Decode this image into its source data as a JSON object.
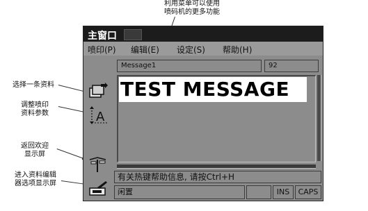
{
  "annotations": {
    "top": [
      "利用菜单可以使用",
      "喷码机的更多功能"
    ],
    "side_1": "选择一条资料",
    "side_2": [
      "调整喷印",
      "资料参数"
    ],
    "side_3": [
      "返回欢迎",
      "显示屏"
    ],
    "side_4": [
      "进入资料编辑",
      "器选项显示屏"
    ]
  },
  "window": {
    "title": "主窗口"
  },
  "menu": {
    "items": [
      "喷印(P)",
      "编辑(E)",
      "设定(S)",
      "帮助(H)"
    ]
  },
  "message": {
    "name": "Message1",
    "number": "92",
    "text": "TEST MESSAGE"
  },
  "hint": "有关热键帮助信息, 请按Ctrl+H",
  "status": {
    "state": "闲置",
    "ins": "INS",
    "caps": "CAPS"
  },
  "icons": [
    "select-message-icon",
    "adjust-parameters-icon",
    "return-welcome-icon",
    "message-editor-icon"
  ]
}
